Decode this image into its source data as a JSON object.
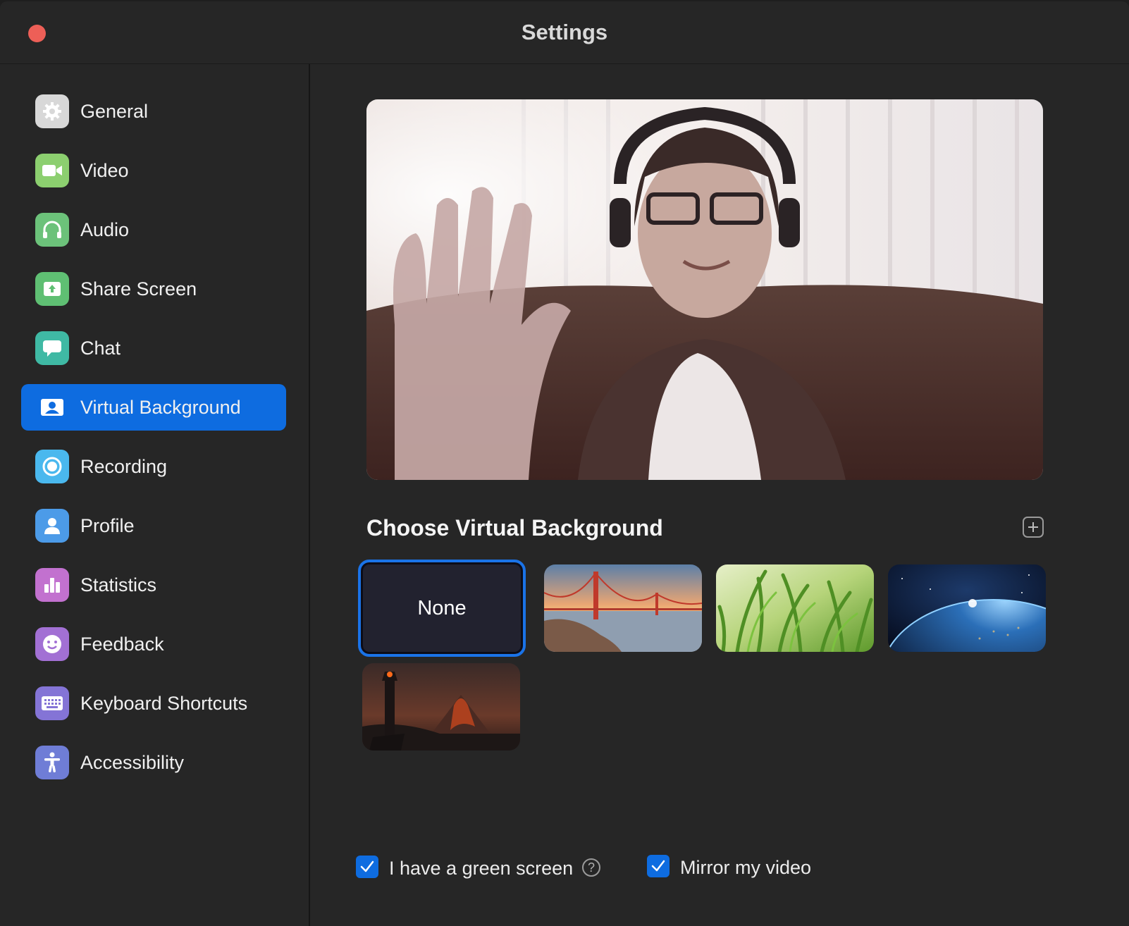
{
  "window": {
    "title": "Settings"
  },
  "sidebar": {
    "items": [
      {
        "label": "General",
        "icon": "gear-icon",
        "color": "#d8d8d8"
      },
      {
        "label": "Video",
        "icon": "video-camera-icon",
        "color": "#8ccf6f"
      },
      {
        "label": "Audio",
        "icon": "headphones-icon",
        "color": "#6cc27a"
      },
      {
        "label": "Share Screen",
        "icon": "share-screen-icon",
        "color": "#5fbf73"
      },
      {
        "label": "Chat",
        "icon": "chat-bubble-icon",
        "color": "#3fb9a4"
      },
      {
        "label": "Virtual Background",
        "icon": "virtual-background-icon",
        "color": "#0e6ce0",
        "active": true
      },
      {
        "label": "Recording",
        "icon": "recording-icon",
        "color": "#4ab8ee"
      },
      {
        "label": "Profile",
        "icon": "profile-icon",
        "color": "#4c9be8"
      },
      {
        "label": "Statistics",
        "icon": "bar-chart-icon",
        "color": "#c271cf"
      },
      {
        "label": "Feedback",
        "icon": "smiley-icon",
        "color": "#a270d4"
      },
      {
        "label": "Keyboard Shortcuts",
        "icon": "keyboard-icon",
        "color": "#8474d6"
      },
      {
        "label": "Accessibility",
        "icon": "accessibility-icon",
        "color": "#6f7dd6"
      }
    ]
  },
  "main": {
    "section_title": "Choose Virtual Background",
    "backgrounds": [
      {
        "label": "None",
        "selected": true
      },
      {
        "name": "golden-gate-bridge"
      },
      {
        "name": "grass"
      },
      {
        "name": "earth-from-space"
      },
      {
        "name": "dark-tower-volcano"
      }
    ],
    "green_screen": {
      "label": "I have a green screen",
      "checked": true
    },
    "mirror": {
      "label": "Mirror my video",
      "checked": true
    }
  },
  "colors": {
    "accent": "#0e6ce0",
    "background": "#262626",
    "close": "#ed5f57"
  }
}
